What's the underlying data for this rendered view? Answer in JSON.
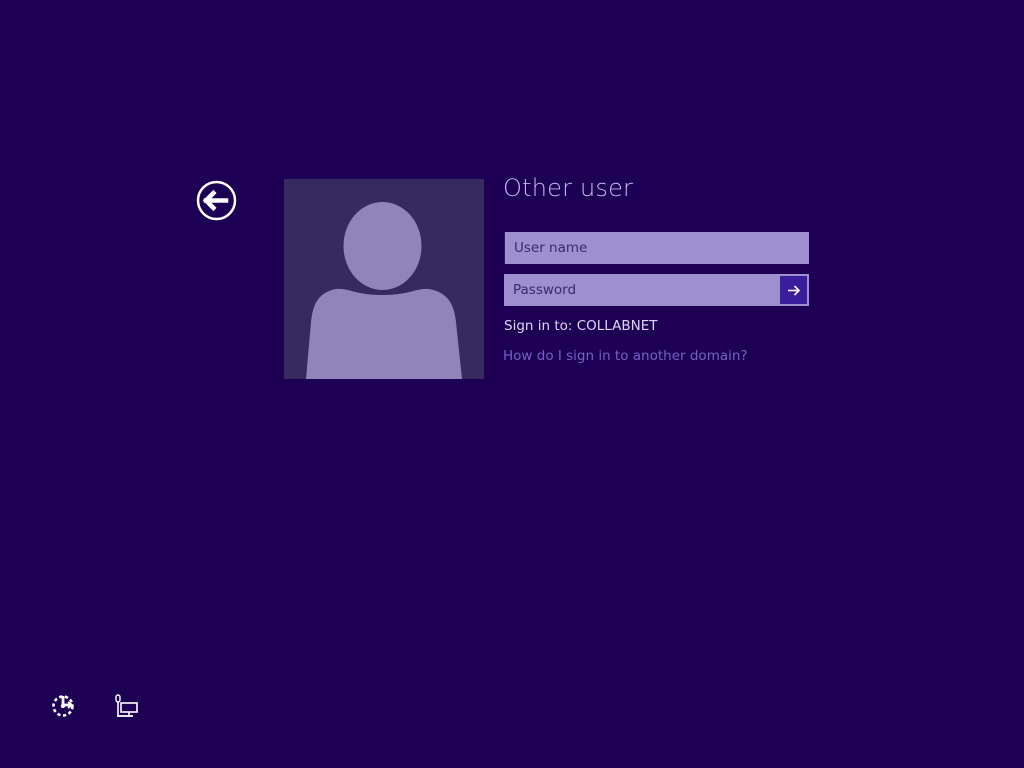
{
  "login": {
    "title": "Other user",
    "username_placeholder": "User name",
    "password_placeholder": "Password",
    "sign_in_to": "Sign in to: COLLABNET",
    "domain_help_link": "How do I sign in to another domain?"
  },
  "icons": {
    "back": "back-arrow-circle-icon",
    "avatar": "user-silhouette-icon",
    "submit": "arrow-right-icon",
    "ease_of_access": "ease-of-access-icon",
    "network": "network-icon"
  },
  "colors": {
    "background": "#1d0054",
    "field": "#9e8fce",
    "submit_button": "#3a1d9a",
    "link": "#7560c7"
  }
}
